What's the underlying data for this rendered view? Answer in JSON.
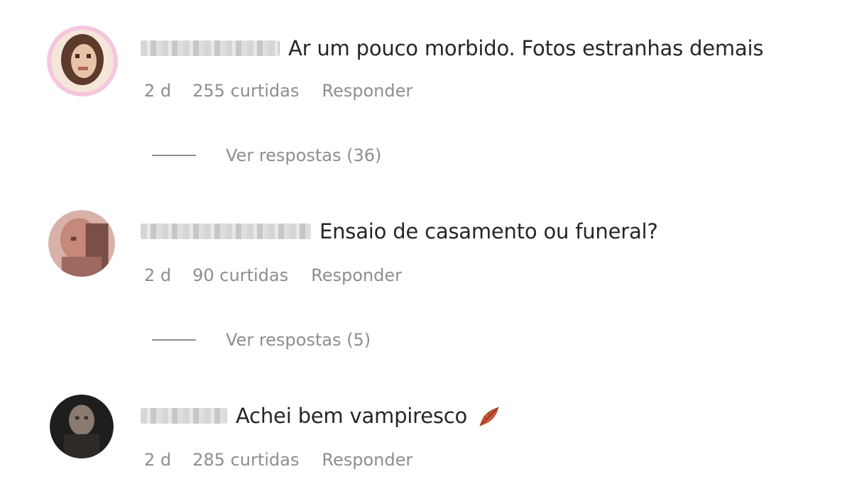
{
  "comments": [
    {
      "text": "Ar um pouco morbido. Fotos estranhas demais",
      "time": "2 d",
      "likes": "255 curtidas",
      "reply_label": "Responder",
      "replies_label": "Ver respostas (36)",
      "avatar_colors": [
        "#f2b8d8",
        "#5a3a2e",
        "#e8c9b0"
      ]
    },
    {
      "text": "Ensaio de casamento ou funeral?",
      "time": "2 d",
      "likes": "90 curtidas",
      "reply_label": "Responder",
      "replies_label": "Ver respostas (5)",
      "avatar_colors": [
        "#c48a7a",
        "#7a4f46",
        "#d9a89a"
      ]
    },
    {
      "text": "Achei bem vampiresco",
      "time": "2 d",
      "likes": "285 curtidas",
      "reply_label": "Responder",
      "emoji_icon": "fallen-leaf-icon",
      "avatar_colors": [
        "#2c2c2c",
        "#8a7a70",
        "#4a3f3a"
      ]
    }
  ],
  "colors": {
    "text_primary": "#262626",
    "text_secondary": "#8e8e8e"
  }
}
